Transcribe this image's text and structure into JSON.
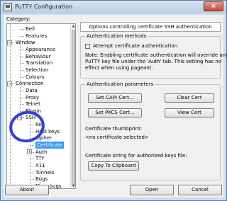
{
  "window": {
    "title": "PuTTY Configuration",
    "close_glyph": "×"
  },
  "category_label": "Category:",
  "tree": [
    {
      "label": "Bell",
      "level": 2
    },
    {
      "label": "Features",
      "level": 2
    },
    {
      "label": "Window",
      "level": 1,
      "expander": "−"
    },
    {
      "label": "Appearance",
      "level": 2
    },
    {
      "label": "Behaviour",
      "level": 2
    },
    {
      "label": "Translation",
      "level": 2
    },
    {
      "label": "Selection",
      "level": 2
    },
    {
      "label": "Colours",
      "level": 2
    },
    {
      "label": "Connection",
      "level": 1,
      "expander": "−"
    },
    {
      "label": "Data",
      "level": 2
    },
    {
      "label": "Proxy",
      "level": 2
    },
    {
      "label": "Telnet",
      "level": 2
    },
    {
      "label": "Rlogin",
      "level": 2
    },
    {
      "label": "SSH",
      "level": 2,
      "expander": "−"
    },
    {
      "label": "Kex",
      "level": 3
    },
    {
      "label": "Host keys",
      "level": 3
    },
    {
      "label": "Cipher",
      "level": 3
    },
    {
      "label": "Certificate",
      "level": 3,
      "selected": true
    },
    {
      "label": "Auth",
      "level": 3,
      "expander": "+"
    },
    {
      "label": "TTY",
      "level": 3
    },
    {
      "label": "X11",
      "level": 3
    },
    {
      "label": "Tunnels",
      "level": 3
    },
    {
      "label": "Bugs",
      "level": 3
    },
    {
      "label": "More bugs",
      "level": 3
    }
  ],
  "panel": {
    "header": "Options controlling certificate SSH authentication",
    "auth_methods": {
      "legend": "Authentication methods",
      "checkbox_label": "Attempt certificate authentication",
      "checked": false,
      "note_line1": "Note: Enabling certificate authentication will override any",
      "note_line2": "PuTTY key file under the 'Auth' tab.  This setting has no",
      "note_line3": "effect when using pageant."
    },
    "auth_params": {
      "legend": "Authentication parameters",
      "set_capi": "Set CAPI Cert...",
      "clear_cert": "Clear Cert",
      "set_pkcs": "Set PKCS Cert...",
      "view_cert": "View Cert",
      "thumbprint_label": "Certificate thumbprint:",
      "thumbprint_value": "<no certificate selected>",
      "string_label": "Certificate string for authorized keys file:",
      "copy_button": "Copy To Clipboard"
    }
  },
  "footer": {
    "about": "About",
    "open": "Open",
    "cancel": "Cancel"
  },
  "colors": {
    "selection": "#3399ff",
    "annotation_circle": "#2f3fd6"
  }
}
